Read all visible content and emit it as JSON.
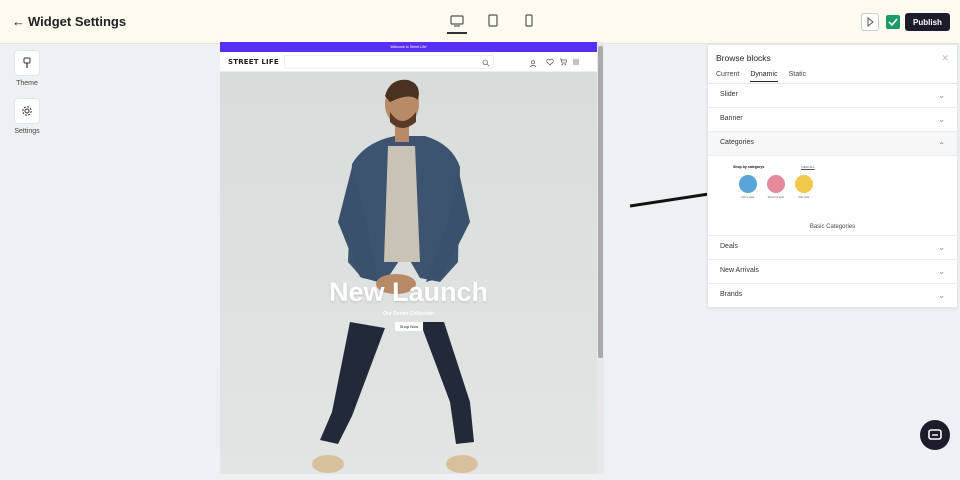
{
  "topbar": {
    "back_icon": "←",
    "title": "Widget Settings",
    "publish_label": "Publish"
  },
  "rail": {
    "theme_label": "Theme",
    "settings_label": "Settings"
  },
  "preview": {
    "announcement": "Welcome to Street Life!",
    "logo": "STREET LIFE",
    "sign_in": "Sign In",
    "hero_title": "New Launch",
    "hero_subtitle": "Our Denim Collection",
    "hero_button": "Shop Now"
  },
  "panel": {
    "title": "Browse blocks",
    "close_icon": "✕",
    "tabs": [
      "Current",
      "Dynamic",
      "Static"
    ],
    "active_tab": "Dynamic",
    "rows_top": [
      "Slider",
      "Banner",
      "Categories"
    ],
    "rows_bottom": [
      "Deals",
      "New Arrivals",
      "Brands"
    ],
    "category_preview": {
      "heading": "Shop by categorys",
      "view_all": "VIEW ALL",
      "items": [
        "Men's wear",
        "Women's wear",
        "Kids wear"
      ]
    },
    "category_card_label": "Basic Categories"
  },
  "colors": {
    "accent": "#5a2ff5",
    "publish": "#1c1c2b",
    "check": "#1d9a6c",
    "whatsapp": "#3cb34a"
  }
}
